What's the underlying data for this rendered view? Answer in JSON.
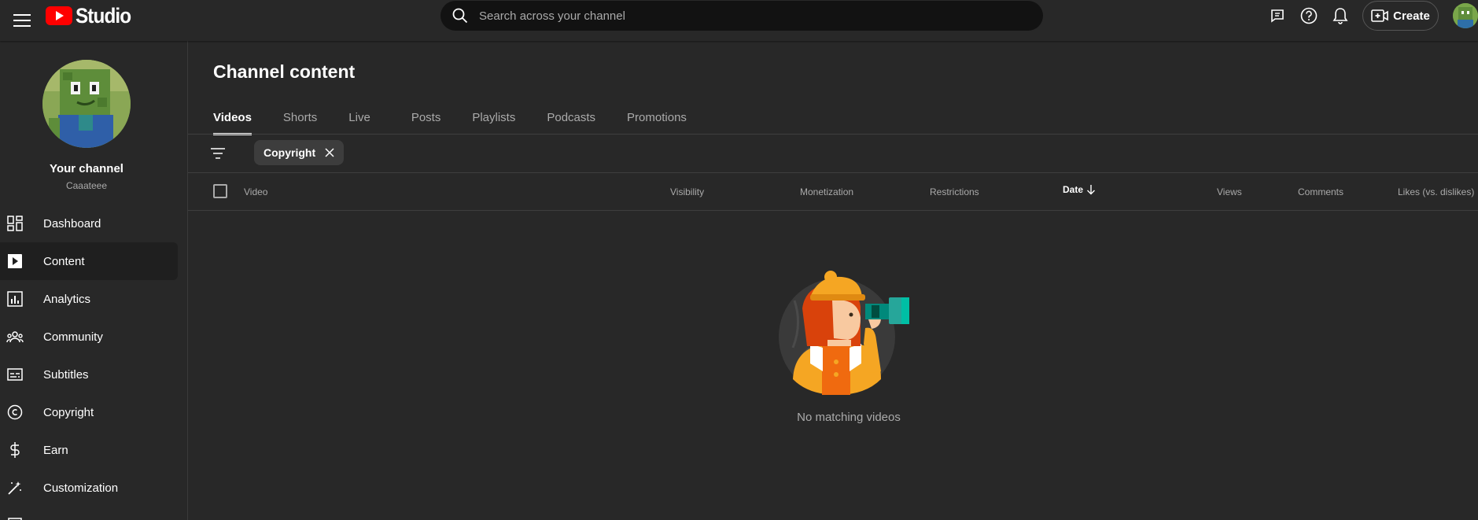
{
  "header": {
    "logo_text": "Studio",
    "search_placeholder": "Search across your channel",
    "create_label": "Create",
    "icons": [
      "menu-icon",
      "youtube-logo-icon",
      "search-icon",
      "feedback-icon",
      "help-icon",
      "notifications-icon",
      "create-video-icon",
      "account-avatar"
    ]
  },
  "channel": {
    "title": "Your channel",
    "handle": "Caaateee"
  },
  "sidebar": {
    "items": [
      {
        "label": "Dashboard",
        "icon": "dashboard-icon"
      },
      {
        "label": "Content",
        "icon": "content-icon",
        "active": true
      },
      {
        "label": "Analytics",
        "icon": "analytics-icon"
      },
      {
        "label": "Community",
        "icon": "community-icon"
      },
      {
        "label": "Subtitles",
        "icon": "subtitles-icon"
      },
      {
        "label": "Copyright",
        "icon": "copyright-icon"
      },
      {
        "label": "Earn",
        "icon": "earn-icon"
      },
      {
        "label": "Customization",
        "icon": "customization-icon"
      }
    ]
  },
  "main": {
    "title": "Channel content",
    "tabs": [
      {
        "label": "Videos",
        "active": true
      },
      {
        "label": "Shorts"
      },
      {
        "label": "Live"
      },
      {
        "label": "Posts"
      },
      {
        "label": "Playlists"
      },
      {
        "label": "Podcasts"
      },
      {
        "label": "Promotions"
      }
    ],
    "filter_chip": "Copyright",
    "columns": {
      "video": "Video",
      "visibility": "Visibility",
      "monetization": "Monetization",
      "restrictions": "Restrictions",
      "date": "Date",
      "views": "Views",
      "comments": "Comments",
      "likes": "Likes (vs. dislikes)"
    },
    "empty_message": "No matching videos"
  },
  "colors": {
    "background": "#282828",
    "search_bg": "#121212",
    "youtube_red": "#ff0000",
    "active_nav_bg": "#1f1f1f",
    "muted_text": "#aaaaaa"
  }
}
